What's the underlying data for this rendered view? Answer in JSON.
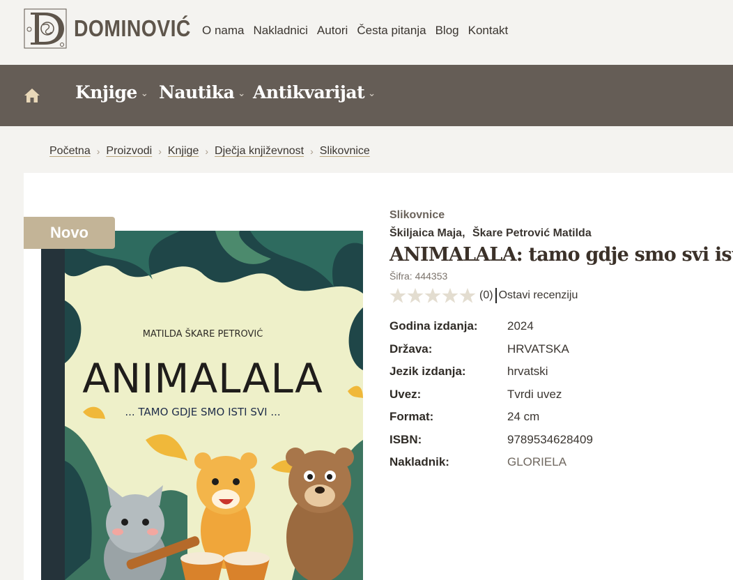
{
  "brand": {
    "name": "DOMINOVIĆ",
    "logo_icon": "ornate-d-monogram"
  },
  "top_nav": [
    "O nama",
    "Nakladnici",
    "Autori",
    "Česta pitanja",
    "Blog",
    "Kontakt"
  ],
  "category_nav": {
    "home_icon": "home-icon",
    "items": [
      {
        "label": "Knjige"
      },
      {
        "label": "Nautika"
      },
      {
        "label": "Antikvarijat"
      }
    ]
  },
  "breadcrumb": [
    "Početna",
    "Proizvodi",
    "Knjige",
    "Dječja književnost",
    "Slikovnice"
  ],
  "product": {
    "badge": "Novo",
    "category": "Slikovnice",
    "authors": [
      "Škiljaica Maja,",
      "Škare Petrović Matilda"
    ],
    "title": "ANIMALALA: tamo gdje smo svi isti",
    "sku": "Šifra: 444353",
    "rating": {
      "stars": 0,
      "max": 5,
      "count_label": "(0)",
      "review_label": "Ostavi recenziju"
    },
    "specs": [
      {
        "label": "Godina izdanja:",
        "value": "2024"
      },
      {
        "label": "Država:",
        "value": "HRVATSKA"
      },
      {
        "label": "Jezik izdanja:",
        "value": "hrvatski"
      },
      {
        "label": "Uvez:",
        "value": "Tvrdi uvez"
      },
      {
        "label": "Format:",
        "value": "24 cm"
      },
      {
        "label": "ISBN:",
        "value": "9789534628409"
      },
      {
        "label": "Nakladnik:",
        "value": "GLORIELA"
      }
    ],
    "cover": {
      "author": "MATILDA ŠKARE PETROVIĆ",
      "title": "ANIMALALA",
      "subtitle": "... TAMO GDJE SMO ISTI SVI ..."
    }
  },
  "colors": {
    "category_bar": "#655d56",
    "badge": "#c3b497",
    "link_underline": "#b9a57d",
    "star_empty": "#e3ddd0"
  }
}
